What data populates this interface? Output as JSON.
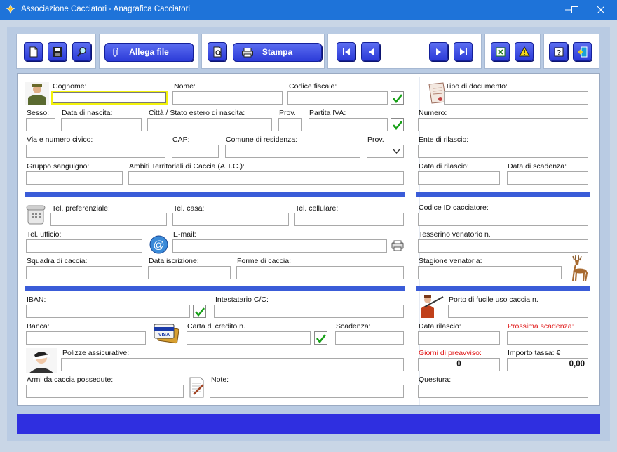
{
  "window": {
    "title": "Associazione Cacciatori - Anagrafica Cacciatori"
  },
  "toolbar": {
    "attach_label": "Allega file",
    "print_label": "Stampa"
  },
  "personal": {
    "surname_label": "Cognome:",
    "name_label": "Nome:",
    "tax_code_label": "Codice fiscale:",
    "sex_label": "Sesso:",
    "birth_date_label": "Data di nascita:",
    "birth_city_label": "Città / Stato estero di nascita:",
    "birth_prov_label": "Prov.",
    "vat_label": "Partita IVA:",
    "address_label": "Via e numero civico:",
    "zip_label": "CAP:",
    "city_label": "Comune di residenza:",
    "prov_label": "Prov.",
    "blood_label": "Gruppo sanguigno:",
    "atc_label": "Ambiti Territoriali di Caccia (A.T.C.):"
  },
  "contacts": {
    "pref_phone_label": "Tel. preferenziale:",
    "home_phone_label": "Tel. casa:",
    "mobile_label": "Tel. cellulare:",
    "office_phone_label": "Tel. ufficio:",
    "email_label": "E-mail:",
    "team_label": "Squadra di caccia:",
    "signup_date_label": "Data iscrizione:",
    "hunting_forms_label": "Forme di caccia:"
  },
  "finance": {
    "iban_label": "IBAN:",
    "holder_label": "Intestatario C/C:",
    "bank_label": "Banca:",
    "card_label": "Carta di credito n.",
    "expiry_label": "Scadenza:",
    "insurance_label": "Polizze assicurative:",
    "weapons_label": "Armi da caccia possedute:",
    "notes_label": "Note:"
  },
  "document": {
    "doc_type_label": "Tipo di documento:",
    "number_label": "Numero:",
    "issuer_label": "Ente di rilascio:",
    "issue_date_label": "Data di rilascio:",
    "expiry_date_label": "Data di scadenza:"
  },
  "hunter": {
    "id_label": "Codice ID cacciatore:",
    "card_label": "Tesserino venatorio n.",
    "season_label": "Stagione venatoria:"
  },
  "license": {
    "number_label": "Porto di fucile uso caccia n.",
    "issue_date_label": "Data rilascio:",
    "next_expiry_label": "Prossima scadenza:",
    "notice_days_label": "Giorni di preavviso:",
    "tax_amount_label": "Importo tassa: €",
    "police_label": "Questura:",
    "notice_days_value": "0",
    "tax_amount_value": "0,00"
  },
  "colors": {
    "titlebar": "#1e73d9",
    "accent": "#3a5cd8",
    "button": "#2c3bd8",
    "status_bar": "#2f2fe0",
    "focus_border": "#f2f20a",
    "red_label": "#e01818",
    "check_green": "#17a017"
  }
}
